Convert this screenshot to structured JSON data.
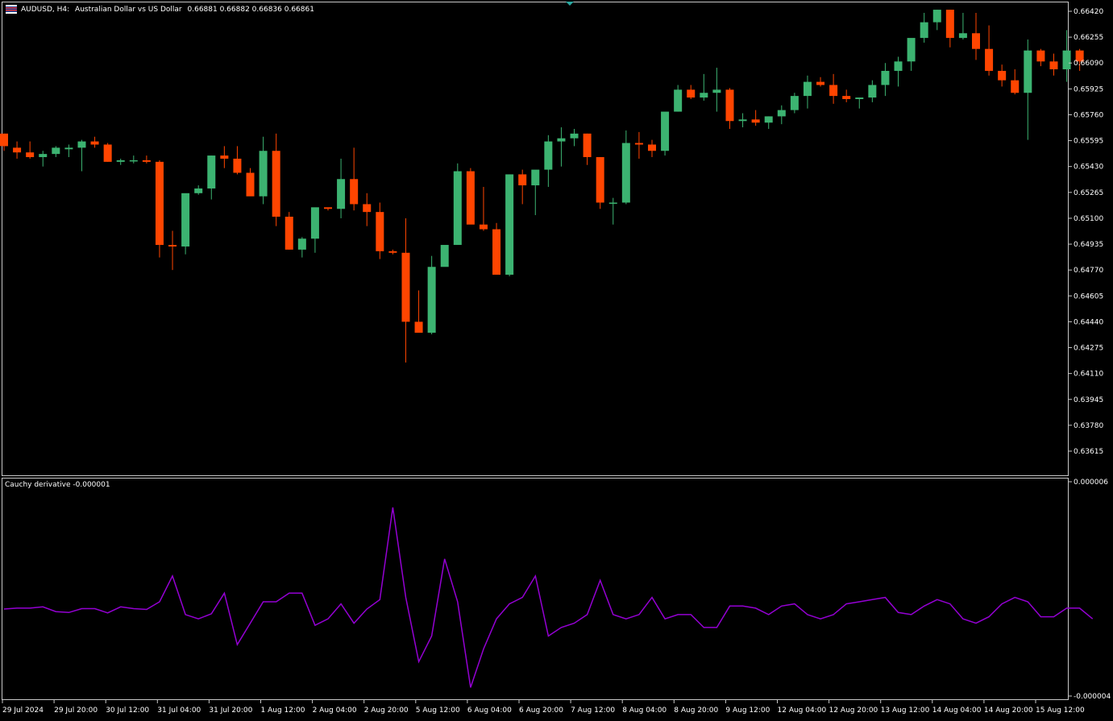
{
  "header": {
    "symbol": "AUDUSD, H4:",
    "description": "Australian Dollar vs US Dollar",
    "ohlc": "0.66881 0.66882 0.66836 0.66861"
  },
  "indicator": {
    "label": "Cauchy derivative -0.000001"
  },
  "colors": {
    "background": "#000000",
    "bull": "#3cb371",
    "bear": "#ff4500",
    "indicator_line": "#9400d3",
    "frame": "#c8c8c8",
    "text": "#ffffff"
  },
  "icons": {
    "symbol": "flag-icon",
    "marker": "shift-marker-icon"
  },
  "chart_data": [
    {
      "type": "candlestick",
      "title": "AUDUSD, H4",
      "price_ticks": [
        "0.66420",
        "0.66255",
        "0.66090",
        "0.65925",
        "0.65760",
        "0.65595",
        "0.65430",
        "0.65265",
        "0.65100",
        "0.64935",
        "0.64770",
        "0.64605",
        "0.64440",
        "0.64275",
        "0.64110",
        "0.63945",
        "0.63780",
        "0.63615"
      ],
      "ylim": [
        0.6354,
        0.6648
      ],
      "x_labels": [
        "29 Jul 2024",
        "29 Jul 20:00",
        "30 Jul 12:00",
        "31 Jul 04:00",
        "31 Jul 20:00",
        "1 Aug 12:00",
        "2 Aug 04:00",
        "2 Aug 20:00",
        "5 Aug 12:00",
        "6 Aug 04:00",
        "6 Aug 20:00",
        "7 Aug 12:00",
        "8 Aug 04:00",
        "8 Aug 20:00",
        "9 Aug 12:00",
        "12 Aug 04:00",
        "12 Aug 20:00",
        "13 Aug 12:00",
        "14 Aug 04:00",
        "14 Aug 20:00",
        "15 Aug 12:00"
      ],
      "candles": [
        [
          0.6564,
          0.6564,
          0.6553,
          0.6556
        ],
        [
          0.6555,
          0.6559,
          0.6548,
          0.6552
        ],
        [
          0.6552,
          0.6559,
          0.6548,
          0.6549
        ],
        [
          0.6549,
          0.6553,
          0.6543,
          0.6551
        ],
        [
          0.6551,
          0.6556,
          0.6549,
          0.6555
        ],
        [
          0.6554,
          0.6557,
          0.6549,
          0.6555
        ],
        [
          0.6555,
          0.656,
          0.654,
          0.6559
        ],
        [
          0.6559,
          0.6562,
          0.6555,
          0.6557
        ],
        [
          0.6557,
          0.6558,
          0.6546,
          0.6546
        ],
        [
          0.6546,
          0.6548,
          0.6544,
          0.6547
        ],
        [
          0.6547,
          0.655,
          0.6545,
          0.6547
        ],
        [
          0.6547,
          0.655,
          0.6545,
          0.6546
        ],
        [
          0.6546,
          0.6547,
          0.6485,
          0.6493
        ],
        [
          0.6493,
          0.6502,
          0.6477,
          0.6492
        ],
        [
          0.6492,
          0.652,
          0.6487,
          0.6526
        ],
        [
          0.6526,
          0.6531,
          0.6525,
          0.6529
        ],
        [
          0.6529,
          0.655,
          0.6522,
          0.655
        ],
        [
          0.655,
          0.6556,
          0.6542,
          0.6548
        ],
        [
          0.6548,
          0.6556,
          0.6538,
          0.6539
        ],
        [
          0.6539,
          0.6542,
          0.6528,
          0.6524
        ],
        [
          0.6524,
          0.6562,
          0.6519,
          0.6553
        ],
        [
          0.6553,
          0.6564,
          0.6505,
          0.6511
        ],
        [
          0.6511,
          0.6514,
          0.649,
          0.649
        ],
        [
          0.649,
          0.6498,
          0.6485,
          0.6497
        ],
        [
          0.6497,
          0.6514,
          0.6488,
          0.6517
        ],
        [
          0.6517,
          0.6517,
          0.6515,
          0.6516
        ],
        [
          0.6516,
          0.6548,
          0.651,
          0.6535
        ],
        [
          0.6535,
          0.6555,
          0.6515,
          0.6519
        ],
        [
          0.6519,
          0.6526,
          0.6505,
          0.6514
        ],
        [
          0.6514,
          0.652,
          0.6484,
          0.6489
        ],
        [
          0.6489,
          0.649,
          0.6487,
          0.6488
        ],
        [
          0.6488,
          0.651,
          0.6418,
          0.6444
        ],
        [
          0.6444,
          0.6464,
          0.6443,
          0.6437
        ],
        [
          0.6437,
          0.6486,
          0.6436,
          0.6479
        ],
        [
          0.6479,
          0.6492,
          0.6482,
          0.6493
        ],
        [
          0.6493,
          0.6545,
          0.6493,
          0.654
        ],
        [
          0.654,
          0.6542,
          0.6512,
          0.6506
        ],
        [
          0.6506,
          0.653,
          0.6502,
          0.6503
        ],
        [
          0.6503,
          0.6507,
          0.648,
          0.6474
        ],
        [
          0.6474,
          0.6538,
          0.6473,
          0.6538
        ],
        [
          0.6538,
          0.6541,
          0.6519,
          0.6531
        ],
        [
          0.6531,
          0.654,
          0.6512,
          0.6541
        ],
        [
          0.6541,
          0.6563,
          0.653,
          0.6559
        ],
        [
          0.6559,
          0.6568,
          0.6543,
          0.6561
        ],
        [
          0.6561,
          0.6567,
          0.6556,
          0.6564
        ],
        [
          0.6564,
          0.6564,
          0.6544,
          0.6549
        ],
        [
          0.6549,
          0.6549,
          0.6516,
          0.652
        ],
        [
          0.652,
          0.6523,
          0.6506,
          0.652
        ],
        [
          0.652,
          0.6566,
          0.6519,
          0.6558
        ],
        [
          0.6558,
          0.6565,
          0.6548,
          0.6557
        ],
        [
          0.6557,
          0.656,
          0.6549,
          0.6553
        ],
        [
          0.6553,
          0.6575,
          0.655,
          0.6578
        ],
        [
          0.6578,
          0.6595,
          0.6578,
          0.6592
        ],
        [
          0.6592,
          0.6595,
          0.6586,
          0.6587
        ],
        [
          0.6587,
          0.6602,
          0.6585,
          0.659
        ],
        [
          0.659,
          0.6606,
          0.6578,
          0.6592
        ],
        [
          0.6592,
          0.6593,
          0.6567,
          0.6572
        ],
        [
          0.6572,
          0.6577,
          0.6568,
          0.6573
        ],
        [
          0.6573,
          0.6579,
          0.6569,
          0.6571
        ],
        [
          0.6571,
          0.6575,
          0.6567,
          0.6575
        ],
        [
          0.6575,
          0.6582,
          0.657,
          0.6579
        ],
        [
          0.6579,
          0.659,
          0.6577,
          0.6588
        ],
        [
          0.6588,
          0.6601,
          0.658,
          0.6597
        ],
        [
          0.6597,
          0.66,
          0.6594,
          0.6595
        ],
        [
          0.6595,
          0.6602,
          0.6583,
          0.6588
        ],
        [
          0.6588,
          0.6592,
          0.6584,
          0.6586
        ],
        [
          0.6586,
          0.6587,
          0.658,
          0.6587
        ],
        [
          0.6587,
          0.6598,
          0.6584,
          0.6595
        ],
        [
          0.6595,
          0.6609,
          0.6588,
          0.6604
        ],
        [
          0.6604,
          0.6613,
          0.6594,
          0.661
        ],
        [
          0.661,
          0.6618,
          0.6604,
          0.6625
        ],
        [
          0.6625,
          0.6641,
          0.6622,
          0.6635
        ],
        [
          0.6635,
          0.6643,
          0.663,
          0.6643
        ],
        [
          0.6643,
          0.6643,
          0.6619,
          0.6625
        ],
        [
          0.6625,
          0.6641,
          0.6624,
          0.6628
        ],
        [
          0.6628,
          0.6641,
          0.6611,
          0.6618
        ],
        [
          0.6618,
          0.6633,
          0.6601,
          0.6604
        ],
        [
          0.6604,
          0.6608,
          0.6594,
          0.6598
        ],
        [
          0.6598,
          0.6605,
          0.6589,
          0.659
        ],
        [
          0.659,
          0.6624,
          0.656,
          0.6617
        ],
        [
          0.6617,
          0.6618,
          0.6607,
          0.661
        ],
        [
          0.661,
          0.6615,
          0.6601,
          0.6605
        ],
        [
          0.6605,
          0.663,
          0.6597,
          0.6617
        ],
        [
          0.6617,
          0.6618,
          0.6604,
          0.661
        ]
      ]
    },
    {
      "type": "line",
      "title": "Cauchy derivative",
      "ylim": [
        -4e-06,
        6e-06
      ],
      "y_ticks": [
        "0.000006",
        "-0.000004"
      ],
      "series": [
        {
          "name": "Cauchy derivative",
          "values": [
            6e-08,
            1e-07,
            1e-07,
            1.6e-07,
            -6e-08,
            -1e-07,
            8e-08,
            8e-08,
            -1.2e-07,
            1.6e-07,
            8e-08,
            4e-08,
            4e-07,
            1.6e-06,
            -2e-07,
            -4e-07,
            -1.6e-07,
            8e-07,
            -1.6e-06,
            -6e-07,
            4e-07,
            4e-07,
            8e-07,
            8e-07,
            -7e-07,
            -4e-07,
            3e-07,
            -6e-07,
            6e-08,
            5e-07,
            4.8e-06,
            6e-07,
            -2.4e-06,
            -1.2e-06,
            2.4e-06,
            4e-07,
            -3.6e-06,
            -1.8e-06,
            -4e-07,
            3e-07,
            6e-07,
            1.6e-06,
            -1.2e-06,
            -8e-07,
            -6e-07,
            -2e-07,
            1.4e-06,
            -2e-07,
            -4e-07,
            -2e-07,
            6e-07,
            -4e-07,
            -2e-07,
            -2e-07,
            -8e-07,
            -8e-07,
            2e-07,
            2e-07,
            1e-07,
            -2e-07,
            2e-07,
            3e-07,
            -2e-07,
            -4e-07,
            -2e-07,
            3e-07,
            4e-07,
            5e-07,
            6e-07,
            -1e-07,
            -2e-07,
            2e-07,
            5e-07,
            3e-07,
            -4e-07,
            -6e-07,
            -3e-07,
            3e-07,
            6e-07,
            4e-07,
            -3e-07,
            -3e-07,
            1e-07,
            1e-07,
            -4e-07
          ]
        }
      ]
    }
  ]
}
